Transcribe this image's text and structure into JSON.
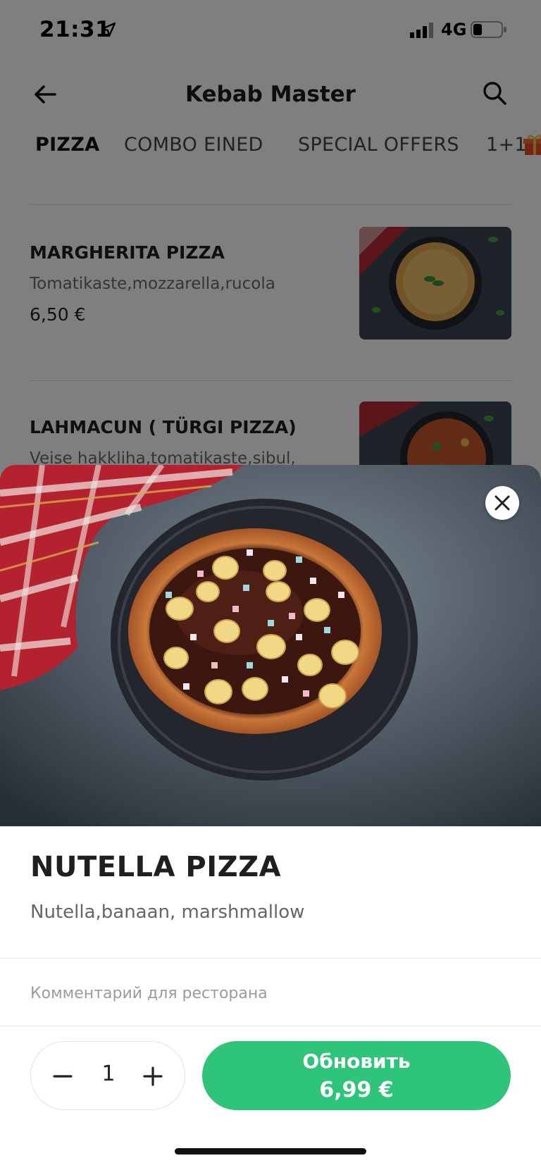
{
  "status": {
    "time": "21:31",
    "network": "4G"
  },
  "header": {
    "title": "Kebab Master"
  },
  "tabs": [
    {
      "label": "PIZZA",
      "active": true
    },
    {
      "label": "COMBO EINED",
      "active": false
    },
    {
      "label": "SPECIAL OFFERS",
      "active": false
    },
    {
      "label": "1+1",
      "active": false
    }
  ],
  "menu": [
    {
      "name": "MARGHERITA PIZZA",
      "description": "Tomatikaste,mozzarella,rucola",
      "price": "6,50 €"
    },
    {
      "name": "LAHMACUN ( TÜRGI PIZZA)",
      "description": "Veise hakkliha,tomatikaste,sibul,"
    }
  ],
  "product": {
    "name": "NUTELLA PIZZA",
    "description": "Nutella,banaan, marshmallow",
    "comment_placeholder": "Комментарий для ресторана",
    "quantity": "1",
    "button_label": "Обновить",
    "button_price": "6,99 €"
  },
  "colors": {
    "accent": "#2ec47a"
  },
  "icons": [
    "back-arrow-icon",
    "search-icon",
    "gift-icon",
    "close-icon",
    "minus-icon",
    "plus-icon",
    "location-arrow-icon"
  ]
}
